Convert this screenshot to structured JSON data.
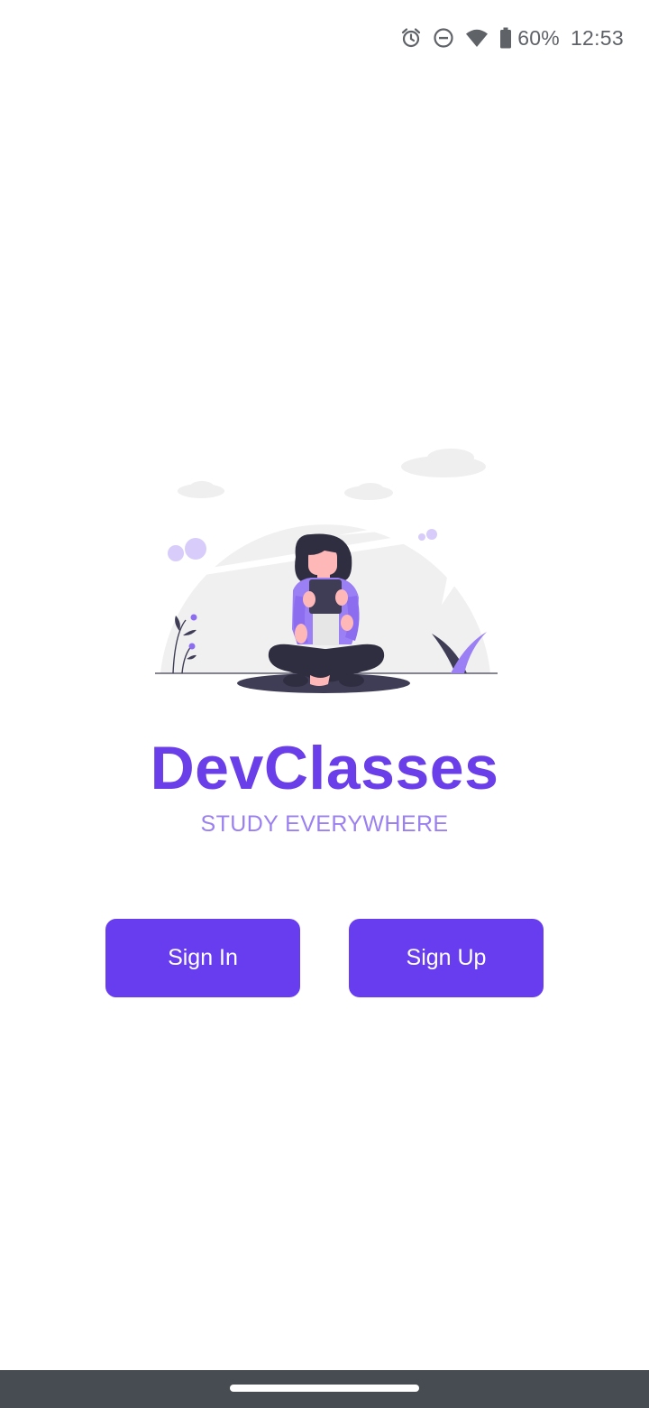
{
  "status_bar": {
    "battery_percent": "60%",
    "time": "12:53",
    "icons": [
      "alarm-icon",
      "do-not-disturb-icon",
      "wifi-icon",
      "battery-icon"
    ]
  },
  "app": {
    "title": "DevClasses",
    "tagline": "STUDY EVERYWHERE"
  },
  "buttons": {
    "sign_in": "Sign In",
    "sign_up": "Sign Up"
  },
  "colors": {
    "accent": "#673def",
    "title": "#6a3ee8",
    "tagline": "#9a80f0",
    "nav_bar": "#474c52"
  }
}
